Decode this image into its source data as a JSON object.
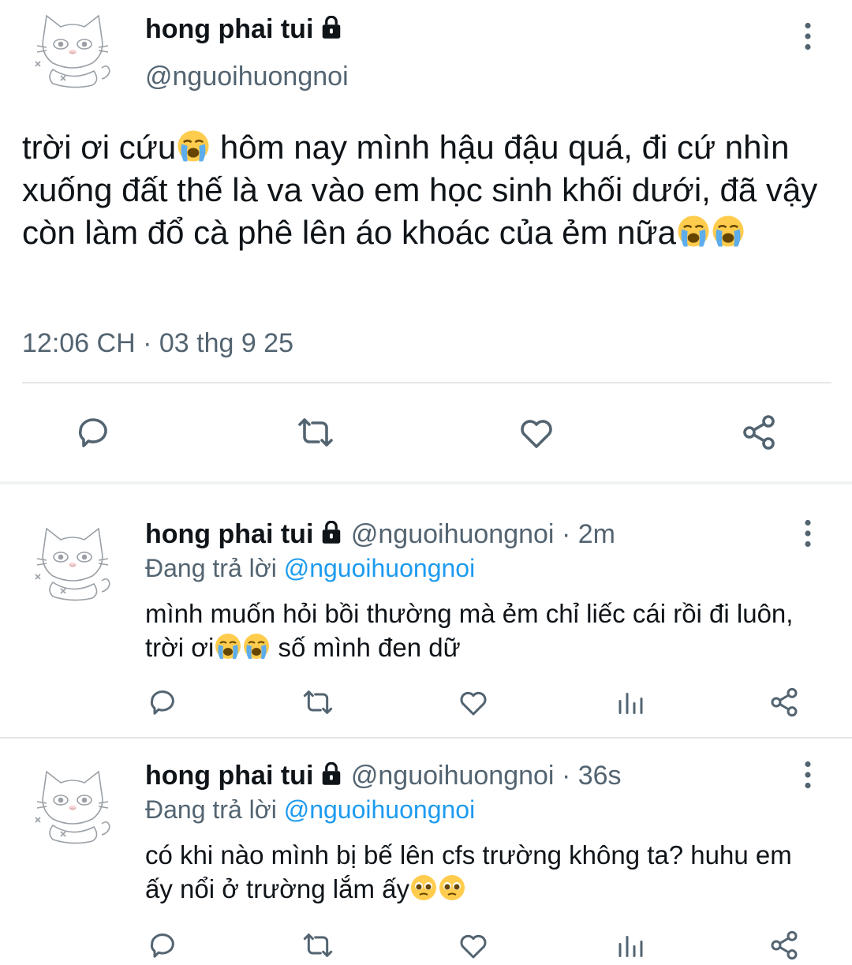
{
  "main_tweet": {
    "display_name": "hong phai tui",
    "handle": "@nguoihuongnoi",
    "text_1": "trời ơi cứu",
    "text_2": " hôm nay mình hậu đậu quá, đi cứ nhìn xuống đất thế là va vào em học sinh khối dưới, đã vậy còn làm đổ cà phê lên áo khoác của ẻm nữa",
    "timestamp": "12:06 CH · 03 thg 9 25",
    "actions": [
      "reply-icon",
      "retweet-icon",
      "like-icon",
      "share-icon"
    ]
  },
  "replies": [
    {
      "display_name": "hong phai tui",
      "handle": "@nguoihuongnoi",
      "time": "· 2m",
      "replying_label": "Đang trả lời",
      "replying_to": "@nguoihuongnoi",
      "text_1": "mình muốn hỏi bồi thường mà ẻm chỉ liếc cái rồi đi luôn, trời ơi",
      "text_2": " số mình đen dữ",
      "emoji": "loudly-crying-face"
    },
    {
      "display_name": "hong phai tui",
      "handle": "@nguoihuongnoi",
      "time": "· 36s",
      "replying_label": "Đang trả lời",
      "replying_to": "@nguoihuongnoi",
      "text_1": "có khi nào mình bị bế lên cfs trường không ta? huhu em ấy nổi ở trường lắm ấy",
      "text_2": "",
      "emoji": "pleading-face"
    }
  ],
  "colors": {
    "accent": "#1d9bf0",
    "muted": "#536471",
    "text": "#0f1419"
  }
}
